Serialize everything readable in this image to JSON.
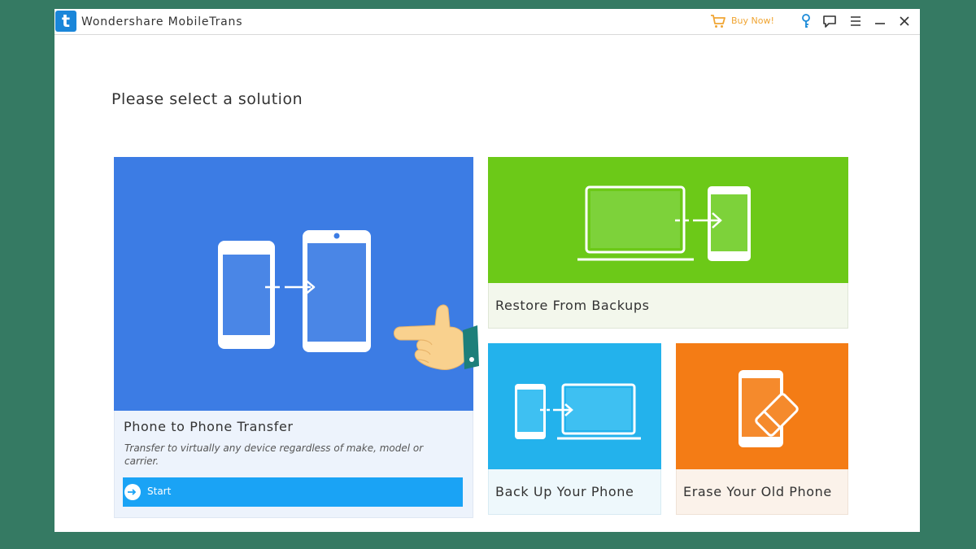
{
  "window": {
    "title": "Wondershare MobileTrans",
    "logo_letter": "t",
    "buy_label": "Buy Now!",
    "controls": [
      "key-icon",
      "feedback-icon",
      "menu-icon",
      "minimize-icon",
      "close-icon"
    ]
  },
  "main": {
    "heading": "Please select a solution"
  },
  "cards": {
    "transfer": {
      "label": "Phone to Phone Transfer",
      "description": "Transfer to virtually any device regardless of make, model or carrier.",
      "start_label": "Start",
      "color": "#3C7CE4"
    },
    "restore": {
      "label": "Restore From Backups",
      "color": "#6CC918"
    },
    "backup": {
      "label": "Back Up Your Phone",
      "color": "#23B2EC"
    },
    "erase": {
      "label": "Erase Your Old Phone",
      "color": "#F47C15"
    }
  },
  "colors": {
    "background": "#357A63",
    "accent_buy": "#F0A533",
    "start_button": "#1AA3F5"
  }
}
